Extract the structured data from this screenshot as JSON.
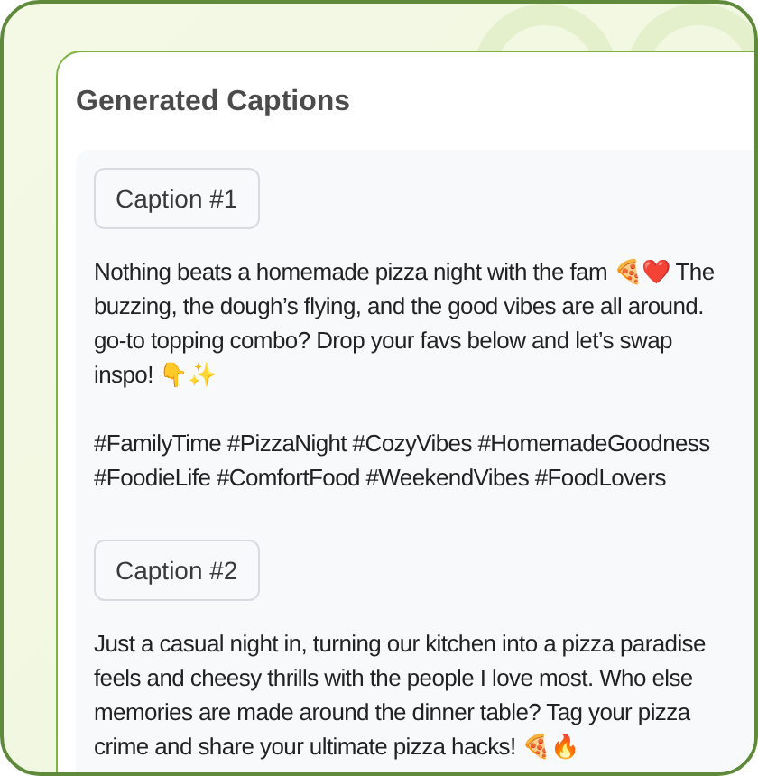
{
  "title": "Generated Captions",
  "captions": [
    {
      "label": "Caption #1",
      "paragraphs": [
        "Nothing beats a homemade pizza night with the fam 🍕❤️ The\nbuzzing, the dough’s flying, and the good vibes are all around.\ngo-to topping combo? Drop your favs below and let’s swap\ninspo! 👇✨",
        "#FamilyTime #PizzaNight #CozyVibes #HomemadeGoodness\n#FoodieLife #ComfortFood #WeekendVibes #FoodLovers"
      ]
    },
    {
      "label": "Caption #2",
      "paragraphs": [
        "Just a casual night in, turning our kitchen into a pizza paradise\nfeels and cheesy thrills with the people I love most. Who else\nmemories are made around the dinner table? Tag your pizza\ncrime and share your ultimate pizza hacks! 🍕🔥"
      ]
    }
  ]
}
